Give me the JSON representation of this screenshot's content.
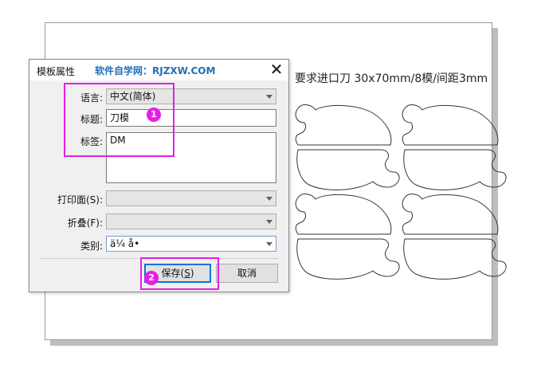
{
  "canvas": {
    "caption": "要求进口刀 30x70mm/8模/间距3mm"
  },
  "dialog": {
    "title": "模板属性",
    "watermark": "软件自学网：RJZXW.COM",
    "close_glyph": "✕",
    "language": {
      "label": "语言:",
      "value": "中文(简体)"
    },
    "title_field": {
      "label": "标题:",
      "value": "刀模"
    },
    "tags": {
      "label": "标签:",
      "value": "DM"
    },
    "print_side": {
      "label": "打印面(S):",
      "value": ""
    },
    "fold": {
      "label": "折叠(F):",
      "value": ""
    },
    "category": {
      "label": "类别:",
      "value": "ä¼ å•"
    },
    "save_button": {
      "prefix": "保存(",
      "hotkey": "S",
      "suffix": ")"
    },
    "cancel_button": "取消"
  },
  "annotations": {
    "marker1": "1",
    "marker2": "2",
    "highlight_color": "#e61ee6"
  }
}
